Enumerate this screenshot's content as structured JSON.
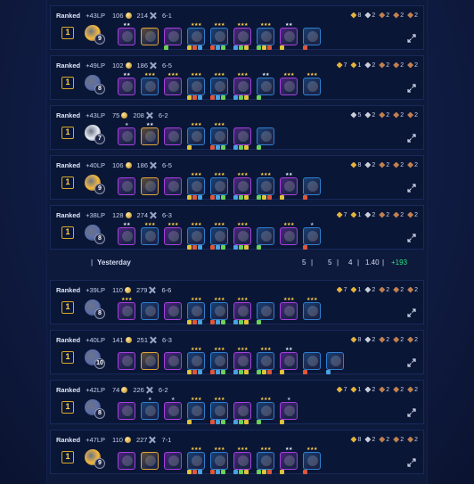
{
  "colors": {
    "gold": "#ffd24a",
    "accent": "#27e27a",
    "cost1": "#7c8797",
    "cost2": "#2ea36b",
    "cost3": "#2f7fd0",
    "cost4": "#a63fe0",
    "cost5": "#e0a53a"
  },
  "matches": [
    {
      "mode": "Ranked",
      "lp": "+43LP",
      "gold": "106",
      "kills": "214",
      "round": "6-1",
      "placement": "1",
      "level": "9",
      "little_color": "#f6b93b",
      "expand": "expand-icon",
      "traits": [
        [
          "#e4b33a",
          "8"
        ],
        [
          "#c9cfd9",
          "2"
        ],
        [
          "#c08050",
          "2"
        ],
        [
          "#c08050",
          "2"
        ],
        [
          "#c08050",
          "2"
        ]
      ],
      "units": [
        [
          4,
          0,
          2
        ],
        [
          5,
          0,
          0
        ],
        [
          4,
          1,
          0
        ],
        [
          3,
          2,
          3
        ],
        [
          3,
          2,
          3
        ],
        [
          4,
          2,
          3
        ],
        [
          3,
          2,
          3
        ],
        [
          4,
          1,
          2
        ],
        [
          3,
          1,
          0
        ]
      ]
    },
    {
      "mode": "Ranked",
      "lp": "+49LP",
      "gold": "102",
      "kills": "186",
      "round": "6-5",
      "placement": "1",
      "level": "8",
      "little_color": "#5b6ea8",
      "traits": [
        [
          "#e4b33a",
          "7"
        ],
        [
          "#e4b33a",
          "1"
        ],
        [
          "#c9cfd9",
          "2"
        ],
        [
          "#c08050",
          "2"
        ],
        [
          "#c08050",
          "2"
        ],
        [
          "#c08050",
          "2"
        ]
      ],
      "units": [
        [
          4,
          0,
          2
        ],
        [
          3,
          0,
          3
        ],
        [
          4,
          0,
          3
        ],
        [
          3,
          2,
          3
        ],
        [
          3,
          2,
          3
        ],
        [
          4,
          2,
          3
        ],
        [
          3,
          1,
          2
        ],
        [
          4,
          0,
          3
        ],
        [
          3,
          0,
          3
        ]
      ]
    },
    {
      "mode": "Ranked",
      "lp": "+43LP",
      "gold": "75",
      "kills": "208",
      "round": "6-2",
      "placement": "1",
      "level": "7",
      "little_color": "#eaeef6",
      "traits": [
        [
          "#c9cfd9",
          "5"
        ],
        [
          "#c9cfd9",
          "2"
        ],
        [
          "#c08050",
          "2"
        ],
        [
          "#c08050",
          "2"
        ],
        [
          "#c08050",
          "2"
        ]
      ],
      "units": [
        [
          4,
          0,
          1
        ],
        [
          5,
          0,
          2
        ],
        [
          4,
          0,
          0
        ],
        [
          3,
          1,
          3
        ],
        [
          3,
          2,
          3
        ],
        [
          4,
          2,
          0
        ],
        [
          3,
          1,
          0
        ]
      ]
    },
    {
      "mode": "Ranked",
      "lp": "+40LP",
      "gold": "106",
      "kills": "186",
      "round": "6-5",
      "placement": "1",
      "level": "9",
      "little_color": "#f6b93b",
      "traits": [
        [
          "#e4b33a",
          "8"
        ],
        [
          "#c9cfd9",
          "2"
        ],
        [
          "#c08050",
          "2"
        ],
        [
          "#c08050",
          "2"
        ],
        [
          "#c08050",
          "2"
        ]
      ],
      "units": [
        [
          4,
          0,
          0
        ],
        [
          5,
          0,
          0
        ],
        [
          4,
          0,
          0
        ],
        [
          3,
          2,
          3
        ],
        [
          3,
          2,
          3
        ],
        [
          4,
          2,
          3
        ],
        [
          3,
          2,
          3
        ],
        [
          4,
          1,
          2
        ],
        [
          3,
          1,
          0
        ]
      ]
    },
    {
      "mode": "Ranked",
      "lp": "+38LP",
      "gold": "128",
      "kills": "274",
      "round": "6-3",
      "placement": "1",
      "level": "8",
      "little_color": "#5b6ea8",
      "traits": [
        [
          "#e4b33a",
          "7"
        ],
        [
          "#e4b33a",
          "1"
        ],
        [
          "#c9cfd9",
          "2"
        ],
        [
          "#c08050",
          "2"
        ],
        [
          "#c08050",
          "2"
        ],
        [
          "#c08050",
          "2"
        ]
      ],
      "units": [
        [
          4,
          0,
          2
        ],
        [
          3,
          0,
          3
        ],
        [
          4,
          0,
          3
        ],
        [
          3,
          2,
          3
        ],
        [
          3,
          2,
          3
        ],
        [
          4,
          2,
          3
        ],
        [
          3,
          1,
          0
        ],
        [
          4,
          0,
          3
        ],
        [
          3,
          1,
          1
        ]
      ]
    },
    {
      "mode": "Ranked",
      "lp": "+39LP",
      "gold": "110",
      "kills": "279",
      "round": "6-6",
      "placement": "1",
      "level": "8",
      "little_color": "#5b6ea8",
      "traits": [
        [
          "#e4b33a",
          "7"
        ],
        [
          "#e4b33a",
          "1"
        ],
        [
          "#c9cfd9",
          "2"
        ],
        [
          "#c08050",
          "2"
        ],
        [
          "#c08050",
          "2"
        ],
        [
          "#c08050",
          "2"
        ]
      ],
      "units": [
        [
          4,
          0,
          3
        ],
        [
          3,
          0,
          0
        ],
        [
          4,
          0,
          0
        ],
        [
          3,
          2,
          3
        ],
        [
          3,
          2,
          3
        ],
        [
          4,
          2,
          3
        ],
        [
          3,
          1,
          0
        ],
        [
          4,
          0,
          3
        ],
        [
          3,
          0,
          3
        ]
      ]
    },
    {
      "mode": "Ranked",
      "lp": "+40LP",
      "gold": "141",
      "kills": "251",
      "round": "6-3",
      "placement": "1",
      "level": "10",
      "little_color": "#5b6ea8",
      "traits": [
        [
          "#e4b33a",
          "8"
        ],
        [
          "#c9cfd9",
          "2"
        ],
        [
          "#c08050",
          "2"
        ],
        [
          "#c08050",
          "2"
        ],
        [
          "#c08050",
          "2"
        ]
      ],
      "units": [
        [
          4,
          0,
          0
        ],
        [
          5,
          0,
          0
        ],
        [
          4,
          0,
          0
        ],
        [
          3,
          2,
          3
        ],
        [
          3,
          2,
          3
        ],
        [
          4,
          2,
          3
        ],
        [
          3,
          2,
          3
        ],
        [
          4,
          1,
          2
        ],
        [
          3,
          1,
          0
        ],
        [
          3,
          1,
          0
        ]
      ]
    },
    {
      "mode": "Ranked",
      "lp": "+42LP",
      "gold": "74",
      "kills": "226",
      "round": "6-2",
      "placement": "1",
      "level": "8",
      "little_color": "#5b6ea8",
      "traits": [
        [
          "#e4b33a",
          "7"
        ],
        [
          "#e4b33a",
          "1"
        ],
        [
          "#c9cfd9",
          "2"
        ],
        [
          "#c08050",
          "2"
        ],
        [
          "#c08050",
          "2"
        ],
        [
          "#c08050",
          "2"
        ]
      ],
      "units": [
        [
          4,
          0,
          0
        ],
        [
          3,
          0,
          1
        ],
        [
          4,
          0,
          1
        ],
        [
          3,
          1,
          3
        ],
        [
          3,
          2,
          3
        ],
        [
          4,
          2,
          0
        ],
        [
          3,
          1,
          3
        ],
        [
          4,
          1,
          1
        ]
      ]
    },
    {
      "mode": "Ranked",
      "lp": "+47LP",
      "gold": "110",
      "kills": "227",
      "round": "7-1",
      "placement": "1",
      "level": "9",
      "little_color": "#f6b93b",
      "traits": [
        [
          "#e4b33a",
          "8"
        ],
        [
          "#c9cfd9",
          "2"
        ],
        [
          "#c08050",
          "2"
        ],
        [
          "#c08050",
          "2"
        ],
        [
          "#c08050",
          "2"
        ]
      ],
      "units": [
        [
          4,
          0,
          0
        ],
        [
          5,
          0,
          0
        ],
        [
          4,
          0,
          0
        ],
        [
          3,
          2,
          3
        ],
        [
          3,
          2,
          3
        ],
        [
          4,
          2,
          3
        ],
        [
          3,
          2,
          3
        ],
        [
          4,
          1,
          2
        ],
        [
          3,
          1,
          3
        ]
      ]
    }
  ],
  "day": {
    "label": "Yesterday",
    "sep": "|",
    "s1": "5",
    "s2": "5",
    "s3": "4",
    "s4": "1.40",
    "lp": "+193"
  }
}
